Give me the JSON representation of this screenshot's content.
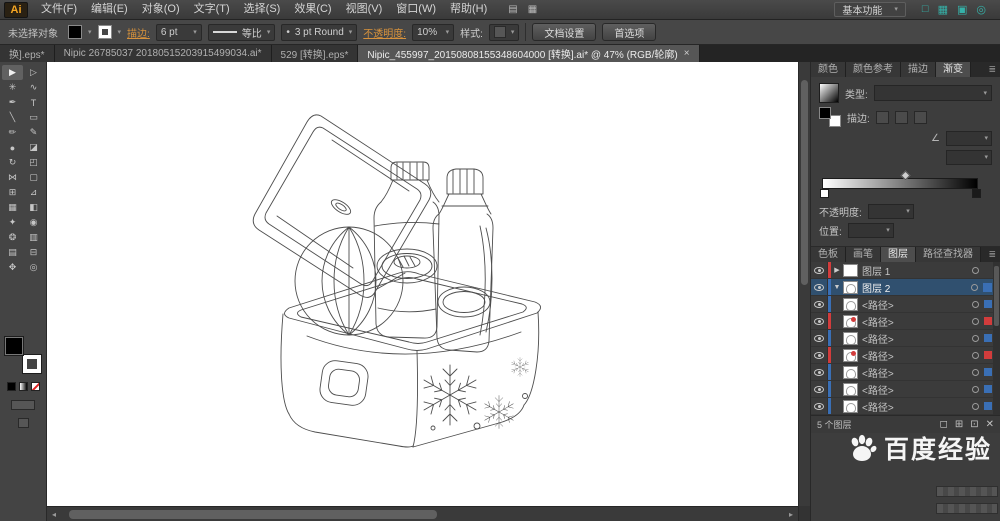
{
  "app": {
    "logo": "Ai",
    "workspace": "基本功能"
  },
  "ui": {
    "caret": "▾",
    "close": "×",
    "scroll_left_icon": "◂",
    "scroll_right_icon": "▸",
    "panel_menu_icon": "≣",
    "angle_icon": "∠",
    "bullet": "•"
  },
  "menubar": {
    "items": [
      {
        "label": "文件(F)"
      },
      {
        "label": "编辑(E)"
      },
      {
        "label": "对象(O)"
      },
      {
        "label": "文字(T)"
      },
      {
        "label": "选择(S)"
      },
      {
        "label": "效果(C)"
      },
      {
        "label": "视图(V)"
      },
      {
        "label": "窗口(W)"
      },
      {
        "label": "帮助(H)"
      }
    ],
    "icons": [
      {
        "name": "bridge-icon",
        "glyph": "▤"
      },
      {
        "name": "arrange-documents-icon",
        "glyph": "▦"
      }
    ],
    "app_bar_icons": [
      {
        "name": "layout-icon",
        "glyph": "□"
      },
      {
        "name": "grid-view-icon",
        "glyph": "▦"
      },
      {
        "name": "swap-view-icon",
        "glyph": "▣"
      },
      {
        "name": "search-icon",
        "glyph": "◎"
      }
    ]
  },
  "controlbar": {
    "status": "未选择对象",
    "stroke_label": "描边:",
    "stroke_weight": "6 pt",
    "width_profile": "等比",
    "brush_name": "3 pt Round",
    "opacity_label": "不透明度:",
    "opacity_value": "10%",
    "style_label": "样式:",
    "document_setup_label": "文档设置",
    "preferences_label": "首选项"
  },
  "document_tabs": [
    {
      "label": "换].eps*",
      "active": false
    },
    {
      "label": "Nipic 26785037 20180515203915499034.ai*",
      "active": false
    },
    {
      "label": "529 [转换].eps*",
      "active": false
    },
    {
      "label": "Nipic_455997_20150808155348604000 [转换].ai* @ 47% (RGB/轮廓)",
      "active": true
    }
  ],
  "toolbar": {
    "tools": [
      {
        "name": "selection-tool",
        "glyph": "▶"
      },
      {
        "name": "direct-selection-tool",
        "glyph": "▷"
      },
      {
        "name": "magic-wand-tool",
        "glyph": "✳"
      },
      {
        "name": "lasso-tool",
        "glyph": "∿"
      },
      {
        "name": "pen-tool",
        "glyph": "✒"
      },
      {
        "name": "type-tool",
        "glyph": "T"
      },
      {
        "name": "line-segment-tool",
        "glyph": "╲"
      },
      {
        "name": "rectangle-tool",
        "glyph": "▭"
      },
      {
        "name": "paintbrush-tool",
        "glyph": "✏"
      },
      {
        "name": "pencil-tool",
        "glyph": "✎"
      },
      {
        "name": "blob-brush-tool",
        "glyph": "●"
      },
      {
        "name": "eraser-tool",
        "glyph": "◪"
      },
      {
        "name": "rotate-tool",
        "glyph": "↻"
      },
      {
        "name": "scale-tool",
        "glyph": "◰"
      },
      {
        "name": "width-tool",
        "glyph": "⋈"
      },
      {
        "name": "free-transform-tool",
        "glyph": "▢"
      },
      {
        "name": "shape-builder-tool",
        "glyph": "⊞"
      },
      {
        "name": "perspective-grid-tool",
        "glyph": "⊿"
      },
      {
        "name": "mesh-tool",
        "glyph": "▦"
      },
      {
        "name": "gradient-tool",
        "glyph": "◧"
      },
      {
        "name": "eyedropper-tool",
        "glyph": "✦"
      },
      {
        "name": "blend-tool",
        "glyph": "◉"
      },
      {
        "name": "symbol-sprayer-tool",
        "glyph": "❂"
      },
      {
        "name": "column-graph-tool",
        "glyph": "▥"
      },
      {
        "name": "artboard-tool",
        "glyph": "▤"
      },
      {
        "name": "slice-tool",
        "glyph": "⊟"
      },
      {
        "name": "hand-tool",
        "glyph": "✥"
      },
      {
        "name": "zoom-tool",
        "glyph": "◎"
      }
    ]
  },
  "panels": {
    "color_dock_tabs": [
      {
        "label": "颜色",
        "active": false
      },
      {
        "label": "颜色参考",
        "active": false
      },
      {
        "label": "描边",
        "active": false
      },
      {
        "label": "渐变",
        "active": true
      }
    ],
    "gradient": {
      "type_label": "类型:",
      "stroke_label": "描边:",
      "opacity_label": "不透明度:",
      "position_label": "位置:"
    },
    "layers_dock_tabs": [
      {
        "label": "色板",
        "active": false
      },
      {
        "label": "画笔",
        "active": false
      },
      {
        "label": "图层",
        "active": true
      },
      {
        "label": "路径查找器",
        "active": false
      }
    ],
    "layers": {
      "rows": [
        {
          "name": "图层 1",
          "caret": "▶"
        },
        {
          "name": "图层 2",
          "caret": "▼"
        },
        {
          "name": "<路径>"
        },
        {
          "name": "<路径>"
        },
        {
          "name": "<路径>"
        },
        {
          "name": "<路径>"
        },
        {
          "name": "<路径>"
        },
        {
          "name": "<路径>"
        },
        {
          "name": "<路径>"
        }
      ],
      "status": "5 个图层",
      "footer_icons": [
        {
          "name": "make-clip-mask-icon",
          "glyph": "◻"
        },
        {
          "name": "new-sublayer-icon",
          "glyph": "⊞"
        },
        {
          "name": "new-layer-icon",
          "glyph": "⊡"
        },
        {
          "name": "delete-layer-icon",
          "glyph": "✕"
        }
      ]
    }
  },
  "theme": {
    "selection_row_blue": "#30506f",
    "layer_accent_red": "#d23c3c",
    "layer_accent_blue": "#3a6fb5",
    "link_orange": "#d7923c",
    "app_bar_teal": "#35b1a8",
    "watermark_white": "#ffffff"
  },
  "watermark": {
    "text": "百度经验"
  }
}
